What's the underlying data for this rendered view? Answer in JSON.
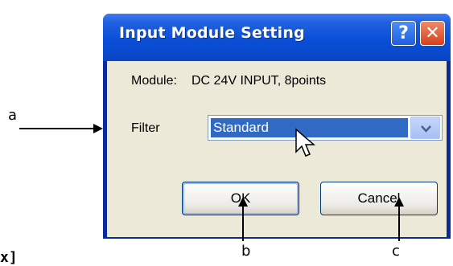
{
  "dialog": {
    "title": "Input Module Setting",
    "help_glyph": "?",
    "close_glyph": "✕"
  },
  "module": {
    "label": "Module:",
    "value": "DC 24V INPUT, 8points"
  },
  "filter": {
    "label": "Filter",
    "selected": "Standard"
  },
  "buttons": {
    "ok": "OK",
    "cancel": "Cancel"
  },
  "callouts": {
    "a": "a",
    "b": "b",
    "c": "c",
    "partial_text": "x]"
  },
  "colors": {
    "titlebar": "#0a4fd8",
    "selection": "#316ac5",
    "client": "#ece9d8"
  }
}
